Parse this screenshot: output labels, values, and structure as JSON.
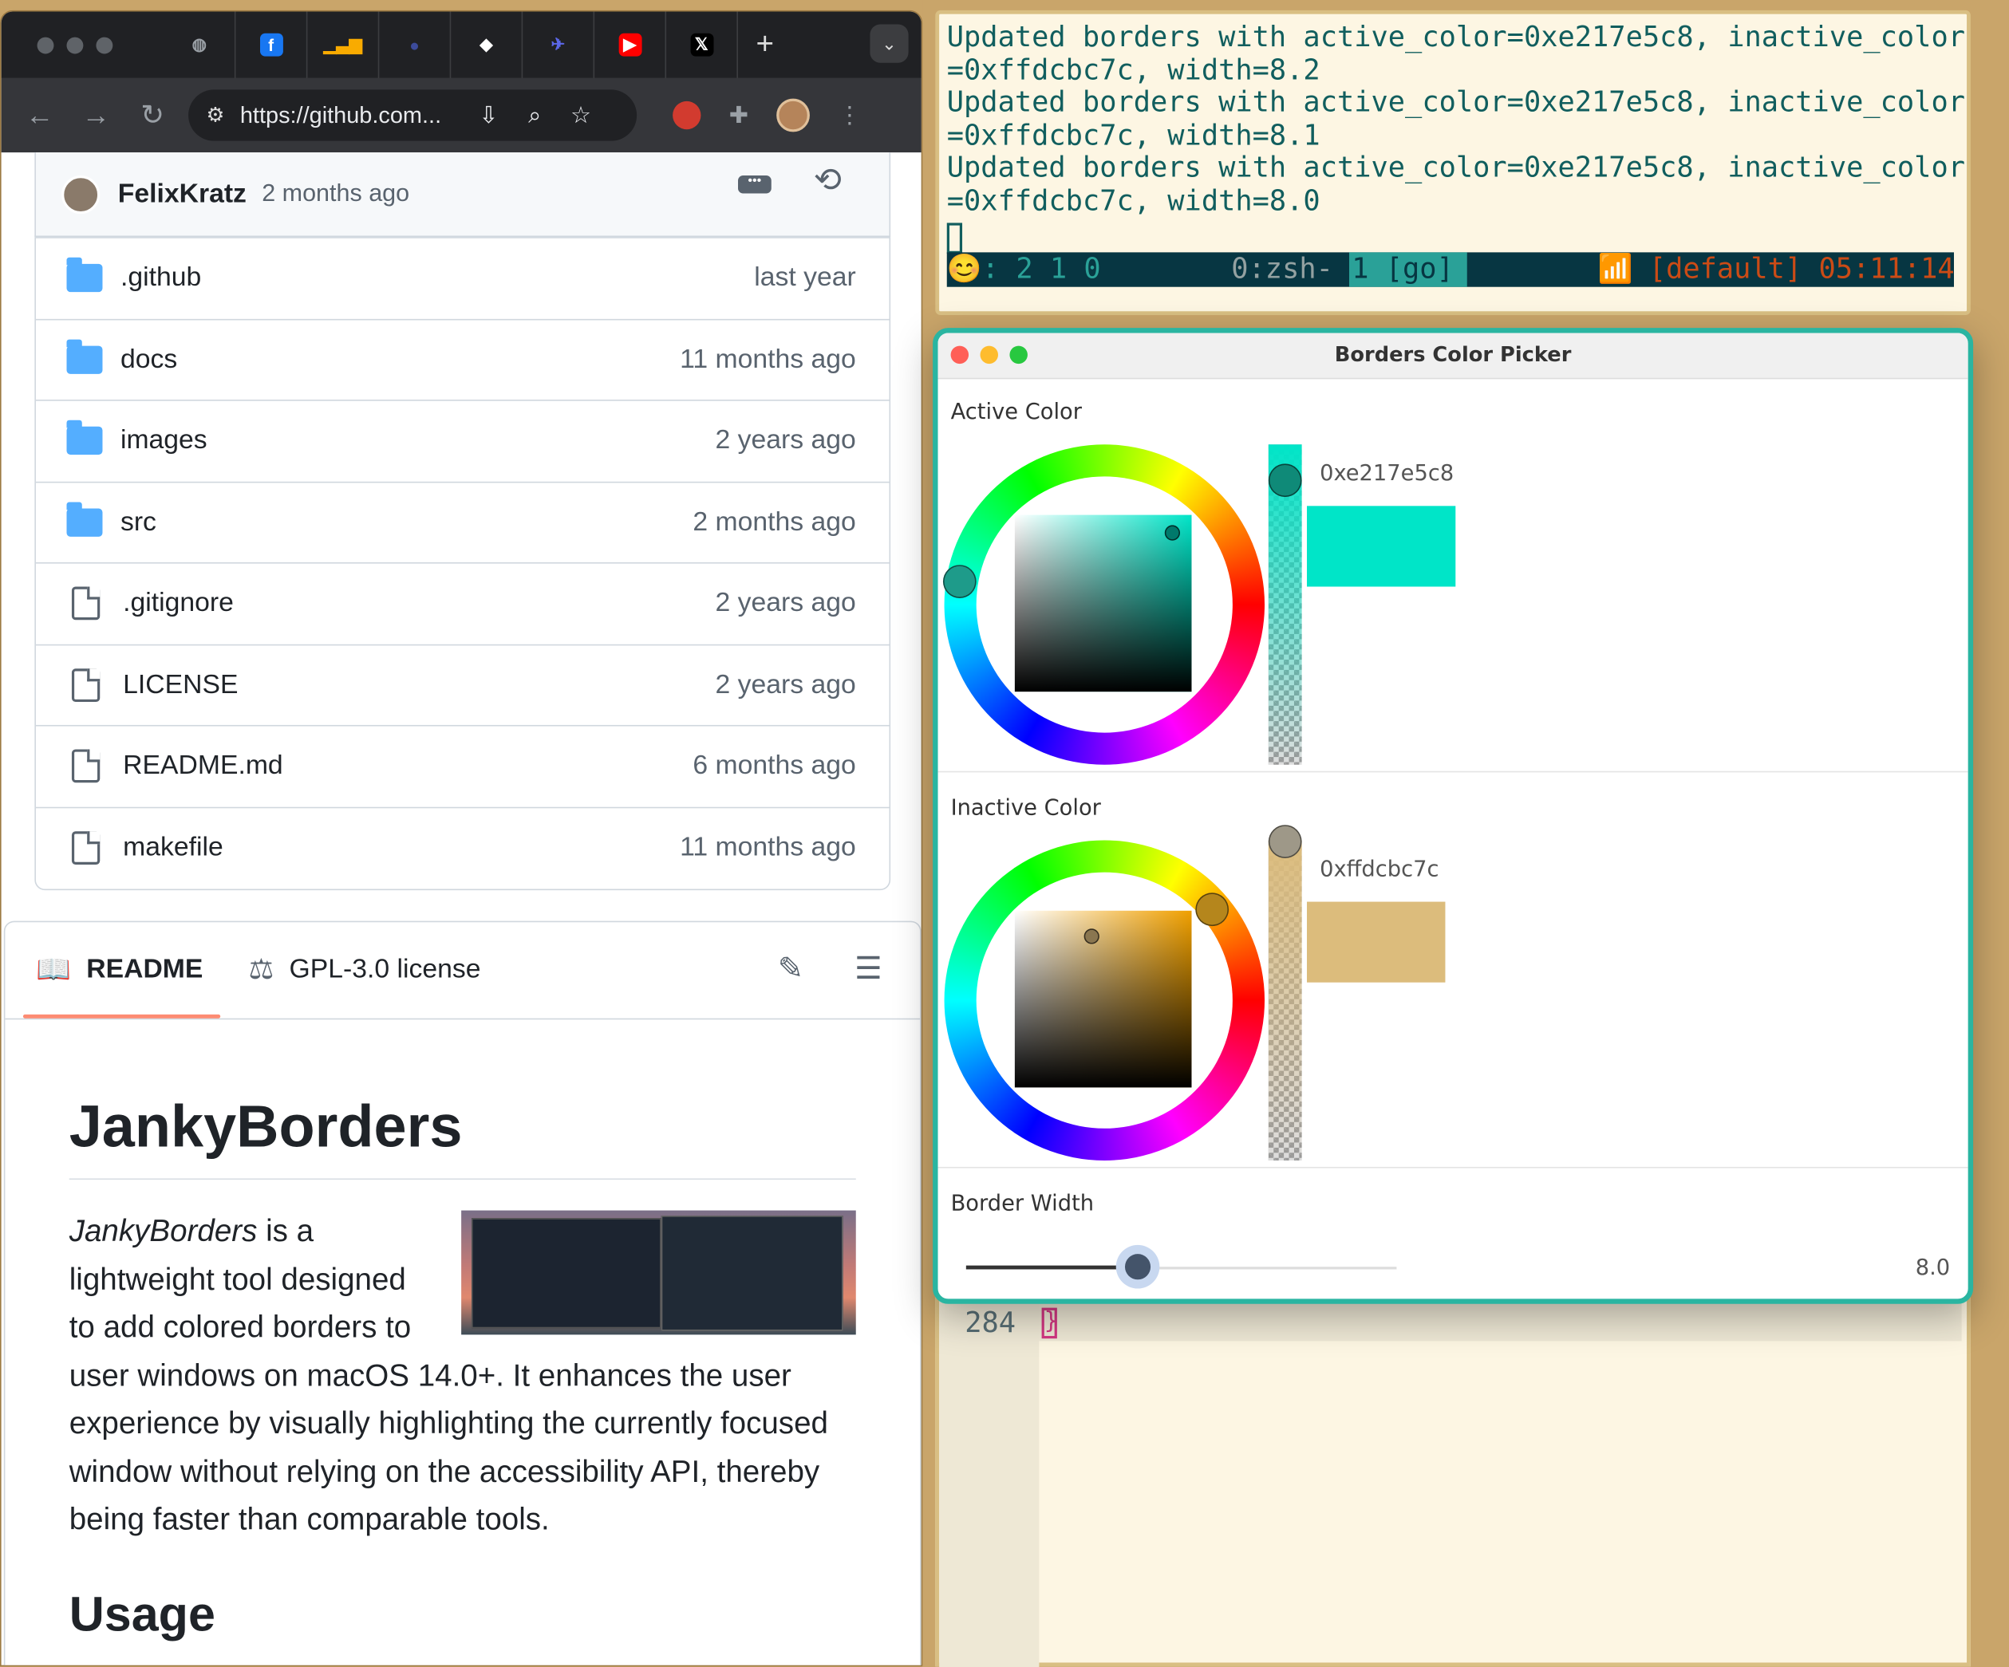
{
  "browser": {
    "url": "https://github.com...",
    "tabs": [
      {
        "icon": "globe-icon",
        "glyph": "◍",
        "bg": "transparent",
        "color": "#9aa0a6"
      },
      {
        "icon": "facebook-icon",
        "glyph": "f",
        "bg": "#1877f2",
        "color": "#ffffff"
      },
      {
        "icon": "analytics-icon",
        "glyph": "▁▃▆",
        "bg": "transparent",
        "color": "#f9ab00"
      },
      {
        "icon": "github-icon",
        "glyph": "●",
        "bg": "transparent",
        "color": "#3c4b9a"
      },
      {
        "icon": "diamond-icon",
        "glyph": "◆",
        "bg": "transparent",
        "color": "#ffffff"
      },
      {
        "icon": "bird-icon",
        "glyph": "✈",
        "bg": "transparent",
        "color": "#5b67e8"
      },
      {
        "icon": "youtube-icon",
        "glyph": "▶",
        "bg": "#ff0000",
        "color": "#ffffff"
      },
      {
        "icon": "x-icon",
        "glyph": "𝕏",
        "bg": "#000000",
        "color": "#ffffff"
      }
    ],
    "new_tab": "+",
    "tab_menu": "⌄",
    "nav": {
      "back": "←",
      "forward": "→",
      "reload": "↻"
    }
  },
  "repo": {
    "commit": {
      "author": "FelixKratz",
      "time": "2 months ago"
    },
    "files": [
      {
        "type": "folder",
        "name": ".github",
        "date": "last year"
      },
      {
        "type": "folder",
        "name": "docs",
        "date": "11 months ago"
      },
      {
        "type": "folder",
        "name": "images",
        "date": "2 years ago"
      },
      {
        "type": "folder",
        "name": "src",
        "date": "2 months ago"
      },
      {
        "type": "file",
        "name": ".gitignore",
        "date": "2 years ago"
      },
      {
        "type": "file",
        "name": "LICENSE",
        "date": "2 years ago"
      },
      {
        "type": "file",
        "name": "README.md",
        "date": "6 months ago"
      },
      {
        "type": "file",
        "name": "makefile",
        "date": "11 months ago"
      }
    ]
  },
  "readme": {
    "tab_readme": "README",
    "tab_license": "GPL-3.0 license",
    "title": "JankyBorders",
    "intro_em": "JankyBorders",
    "intro_rest": " is a lightweight tool designed to add colored borders to user windows on macOS 14.0+. It enhances the user experience by visually highlighting the currently focused window without relying on the accessibility API, thereby being faster than comparable tools.",
    "h2": "Usage"
  },
  "terminal": {
    "lines": [
      "Updated borders with active_color=0xe217e5c8, inactive_color",
      "=0xffdcbc7c, width=8.2",
      "Updated borders with active_color=0xe217e5c8, inactive_color",
      "=0xffdcbc7c, width=8.1",
      "Updated borders with active_color=0xe217e5c8, inactive_color",
      "=0xffdcbc7c, width=8.0"
    ],
    "status": {
      "emoji": "😊",
      "left": ": 2 1 0",
      "window": "0:zsh-",
      "session": "1 [go]",
      "signal": "📶",
      "right": "[default] 05:11:14"
    }
  },
  "editor": {
    "line_number": "284",
    "bracket": "}"
  },
  "picker": {
    "title": "Borders Color Picker",
    "active": {
      "label": "Active Color",
      "hex": "0xe217e5c8",
      "swatch": "#00e5c8",
      "hue": "#00e5c8"
    },
    "inactive": {
      "label": "Inactive Color",
      "hex": "0xffdcbc7c",
      "swatch": "#dcbc7c",
      "hue": "#f0a000"
    },
    "width": {
      "label": "Border Width",
      "value": "8.0",
      "fraction": 0.4
    }
  },
  "colors": {
    "accent": "#2ab5a1",
    "term_fg": "#115e5e",
    "term_bg": "#fdf6e3"
  }
}
